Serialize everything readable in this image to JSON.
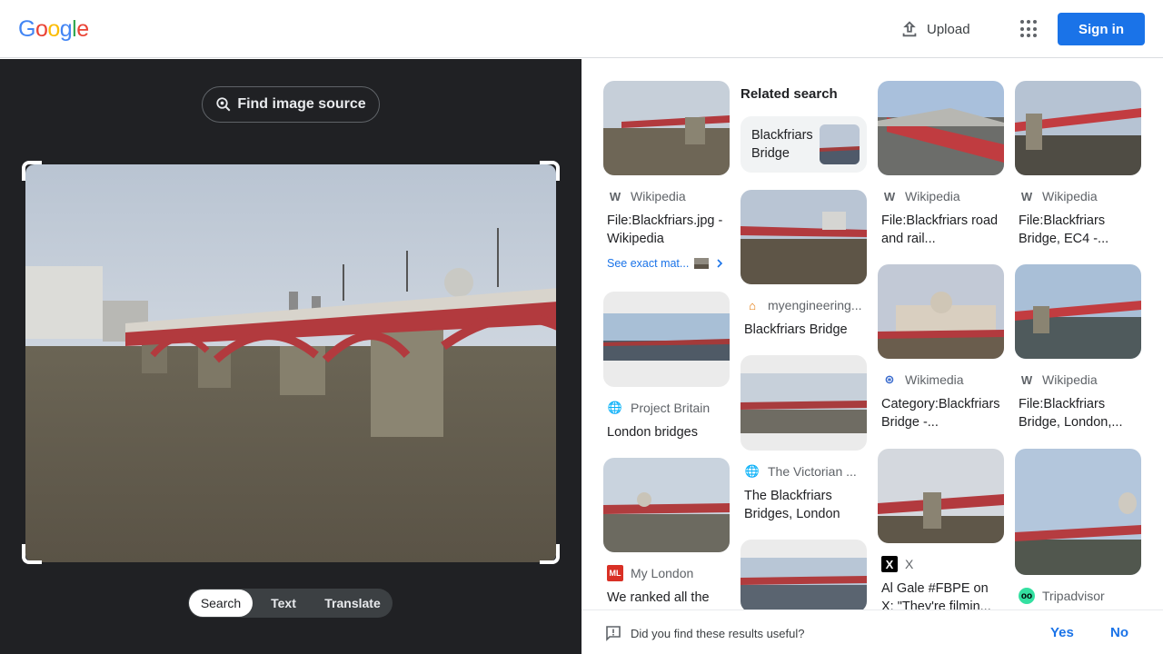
{
  "header": {
    "logo": [
      "G",
      "o",
      "o",
      "g",
      "l",
      "e"
    ],
    "logo_colors": [
      "#4285F4",
      "#EA4335",
      "#FBBC05",
      "#4285F4",
      "#34A853",
      "#EA4335"
    ],
    "upload_label": "Upload",
    "apps_icon": "apps-grid-icon",
    "signin_label": "Sign in"
  },
  "left_panel": {
    "find_source_label": "Find image source",
    "modes": [
      "Search",
      "Text",
      "Translate"
    ],
    "active_mode": "Search"
  },
  "related": {
    "heading": "Related search",
    "chip_label": "Blackfriars Bridge"
  },
  "results": {
    "c1": {
      "source": "Wikipedia",
      "title": "File:Blackfriars.jpg - Wikipedia",
      "exact_label": "See exact mat..."
    },
    "c2": {
      "source": "Project Britain",
      "title": "London bridges"
    },
    "c3": {
      "source": "My London",
      "title": "We ranked all the"
    },
    "c4": {
      "source": "myengineering...",
      "title": "Blackfriars Bridge"
    },
    "c5": {
      "source": "The Victorian ...",
      "title": "The Blackfriars Bridges, London"
    },
    "c6": {
      "source": "Wikipedia",
      "title": "File:Blackfriars road and rail..."
    },
    "c7": {
      "source": "Wikimedia",
      "title": "Category:Blackfriars Bridge -..."
    },
    "c8": {
      "source": "X",
      "title": "Al Gale #FBPE on X: \"They're filmin..."
    },
    "c9": {
      "source": "Wikipedia",
      "title": "File:Blackfriars Bridge, EC4 -..."
    },
    "c10": {
      "source": "Wikipedia",
      "title": "File:Blackfriars Bridge, London,..."
    },
    "c11": {
      "source": "Tripadvisor",
      "title": ""
    }
  },
  "feedback": {
    "question": "Did you find these results useful?",
    "yes_label": "Yes",
    "no_label": "No"
  }
}
